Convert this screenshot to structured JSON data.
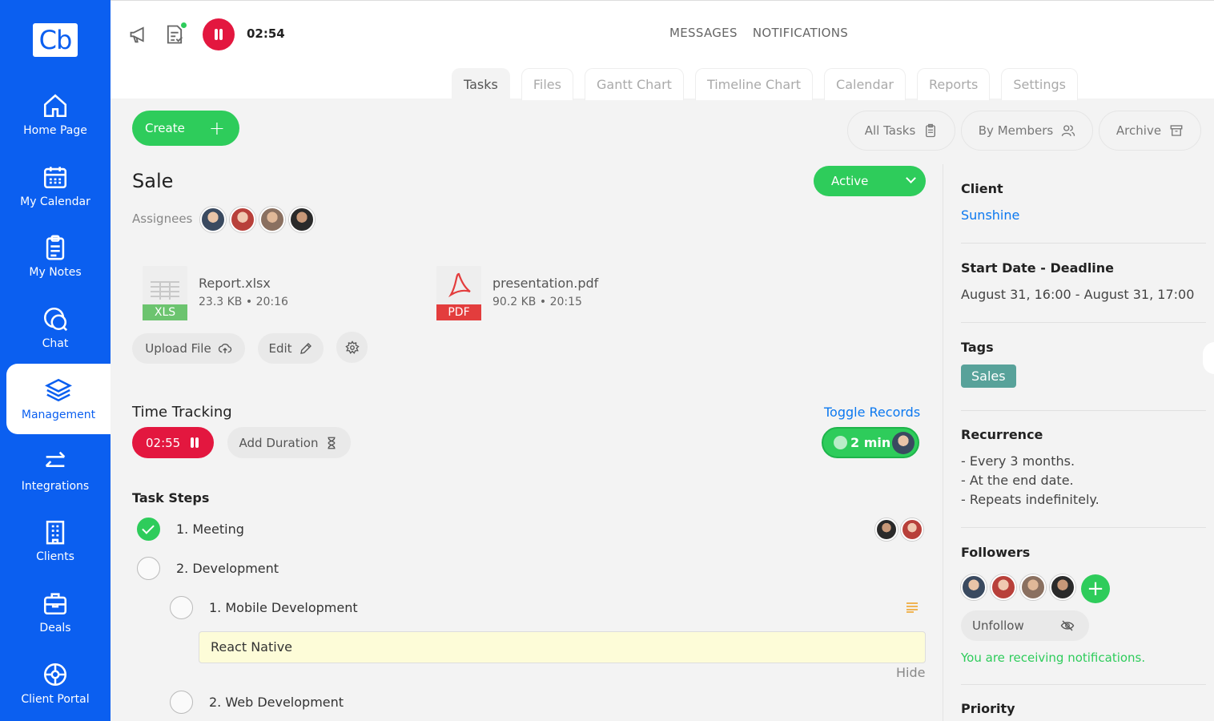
{
  "app": {
    "logo_text": "Cb"
  },
  "sidebar": {
    "items": [
      {
        "label": "Home Page",
        "icon": "home-icon"
      },
      {
        "label": "My Calendar",
        "icon": "calendar-icon"
      },
      {
        "label": "My Notes",
        "icon": "notes-icon"
      },
      {
        "label": "Chat",
        "icon": "chat-icon"
      },
      {
        "label": "Management",
        "icon": "layers-icon",
        "active": true
      },
      {
        "label": "Integrations",
        "icon": "arrows-icon"
      },
      {
        "label": "Clients",
        "icon": "building-icon"
      },
      {
        "label": "Deals",
        "icon": "briefcase-icon"
      },
      {
        "label": "Client Portal",
        "icon": "portal-icon"
      }
    ]
  },
  "topbar": {
    "timer": "02:54",
    "links": [
      "MESSAGES",
      "NOTIFICATIONS"
    ],
    "tabs": [
      "Tasks",
      "Files",
      "Gantt Chart",
      "Timeline Chart",
      "Calendar",
      "Reports",
      "Settings"
    ],
    "active_tab": "Tasks"
  },
  "toolbar": {
    "create_label": "Create",
    "views": [
      "All Tasks",
      "By Members",
      "Archive"
    ]
  },
  "task": {
    "title": "Sale",
    "assignees_label": "Assignees",
    "status": "Active",
    "files": [
      {
        "name": "Report.xlsx",
        "meta": "23.3 KB • 20:16",
        "ext": "XLS",
        "color": "#6cc46f"
      },
      {
        "name": "presentation.pdf",
        "meta": "90.2 KB • 20:15",
        "ext": "PDF",
        "color": "#e33d3d"
      }
    ],
    "upload_label": "Upload File",
    "edit_label": "Edit"
  },
  "time_tracking": {
    "title": "Time Tracking",
    "toggle_label": "Toggle Records",
    "timer": "02:55",
    "add_duration_label": "Add Duration",
    "duration": "2 min"
  },
  "steps": {
    "title": "Task Steps",
    "items": [
      {
        "label": "1. Meeting",
        "done": true
      },
      {
        "label": "2. Development",
        "done": false
      },
      {
        "label": "1. Mobile Development",
        "done": false
      },
      {
        "label": "2. Web Development",
        "done": false
      }
    ],
    "note": "React Native",
    "hide_label": "Hide"
  },
  "details": {
    "client_label": "Client",
    "client_value": "Sunshine",
    "dates_label": "Start Date - Deadline",
    "dates_value": "August 31, 16:00 - August 31, 17:00",
    "tags_label": "Tags",
    "tag": "Sales",
    "recurrence_label": "Recurrence",
    "recurrence": [
      "- Every 3 months.",
      "- At the end date.",
      "- Repeats indefinitely."
    ],
    "followers_label": "Followers",
    "unfollow_label": "Unfollow",
    "notif_text": "You are receiving notifications.",
    "priority_label": "Priority"
  },
  "colors": {
    "brand": "#0b5ff0",
    "success": "#2ecc5b",
    "danger": "#e3173f",
    "link": "#0b78f0",
    "tag": "#58a29a"
  }
}
